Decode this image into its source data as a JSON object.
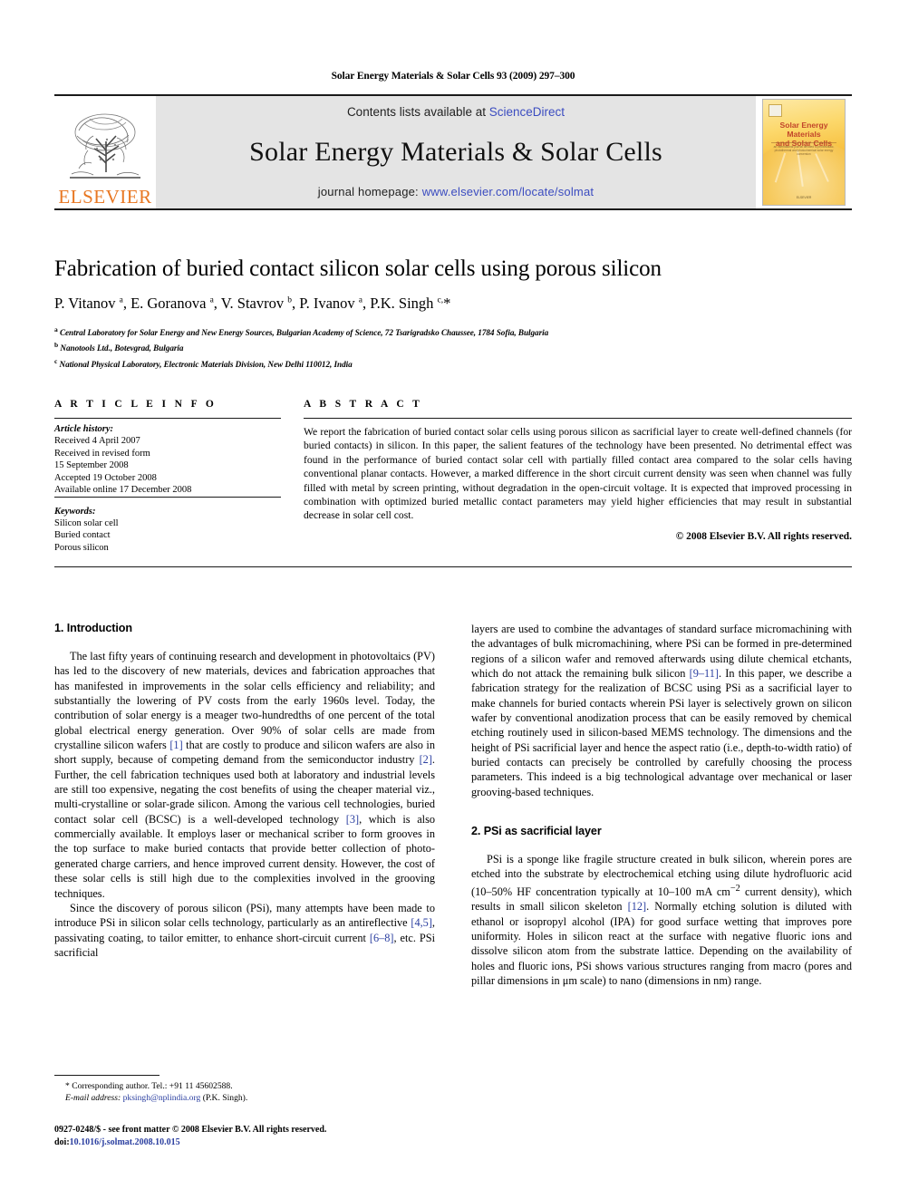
{
  "running_head": "Solar Energy Materials & Solar Cells 93 (2009) 297–300",
  "masthead": {
    "publisher_name": "ELSEVIER",
    "publisher_logo_icon": "elsevier-tree-icon",
    "contents_prefix": "Contents lists available at ",
    "contents_link": "ScienceDirect",
    "journal_title": "Solar Energy Materials & Solar Cells",
    "homepage_prefix": "journal homepage: ",
    "homepage_link": "www.elsevier.com/locate/solmat",
    "cover": {
      "title_line1": "Solar Energy Materials",
      "title_line2": "and Solar Cells",
      "subtitle": "an international journal devoted to photovoltaic, photothermal and photochemical solar energy conversion",
      "footer": "ELSEVIER"
    }
  },
  "colors": {
    "elsevier_orange": "#e87722",
    "link_blue": "#3b4cc0",
    "reference_blue": "#2b3fa0",
    "masthead_gray": "#e4e4e4",
    "cover_yellow": "#f7bf3e"
  },
  "article": {
    "title": "Fabrication of buried contact silicon solar cells using porous silicon",
    "authors_html": "P. Vitanov <sup>a</sup>, E. Goranova <sup>a</sup>, V. Stavrov <sup>b</sup>, P. Ivanov <sup>a</sup>, P.K. Singh <sup>c,</sup>*",
    "authors_plain": "P. Vitanov a, E. Goranova a, V. Stavrov b, P. Ivanov a, P.K. Singh c,*",
    "affiliations": [
      {
        "marker": "a",
        "text": "Central Laboratory for Solar Energy and New Energy Sources, Bulgarian Academy of Science, 72 Tsarigradsko Chaussee, 1784 Sofia, Bulgaria"
      },
      {
        "marker": "b",
        "text": "Nanotools Ltd., Botevgrad, Bulgaria"
      },
      {
        "marker": "c",
        "text": "National Physical Laboratory, Electronic Materials Division, New Delhi 110012, India"
      }
    ]
  },
  "article_info": {
    "heading": "A R T I C L E  I N F O",
    "history_label": "Article history:",
    "history_lines": [
      "Received 4 April 2007",
      "Received in revised form",
      "15 September 2008",
      "Accepted 19 October 2008",
      "Available online 17 December 2008"
    ],
    "keywords_label": "Keywords:",
    "keywords": [
      "Silicon solar cell",
      "Buried contact",
      "Porous silicon"
    ]
  },
  "abstract": {
    "heading": "A B S T R A C T",
    "text": "We report the fabrication of buried contact solar cells using porous silicon as sacrificial layer to create well-defined channels (for buried contacts) in silicon. In this paper, the salient features of the technology have been presented. No detrimental effect was found in the performance of buried contact solar cell with partially filled contact area compared to the solar cells having conventional planar contacts. However, a marked difference in the short circuit current density was seen when channel was fully filled with metal by screen printing, without degradation in the open-circuit voltage. It is expected that improved processing in combination with optimized buried metallic contact parameters may yield higher efficiencies that may result in substantial decrease in solar cell cost.",
    "copyright": "© 2008 Elsevier B.V. All rights reserved."
  },
  "body": {
    "section1_heading": "1.  Introduction",
    "section1_p1_a": "The last fifty years of continuing research and development in photovoltaics (PV) has led to the discovery of new materials, devices and fabrication approaches that has manifested in improvements in the solar cells efficiency and reliability; and substantially the lowering of PV costs from the early 1960s level. Today, the contribution of solar energy is a meager two-hundredths of one percent of the total global electrical energy generation. Over 90% of solar cells are made from crystalline silicon wafers ",
    "section1_p1_ref1": "[1]",
    "section1_p1_b": " that are costly to produce and silicon wafers are also in short supply, because of competing demand from the semiconductor industry ",
    "section1_p1_ref2": "[2]",
    "section1_p1_c": ". Further, the cell fabrication techniques used both at laboratory and industrial levels are still too expensive, negating the cost benefits of using the cheaper material viz., multi-crystalline or solar-grade silicon. Among the various cell technologies, buried contact solar cell (BCSC) is a well-developed technology ",
    "section1_p1_ref3": "[3]",
    "section1_p1_d": ", which is also commercially available. It employs laser or mechanical scriber to form grooves in the top surface to make buried contacts that provide better collection of photo-generated charge carriers, and hence improved current density. However, the cost of these solar cells is still high due to the complexities involved in the grooving techniques.",
    "section1_p2_a": "Since the discovery of porous silicon (PSi), many attempts have been made to introduce PSi in silicon solar cells technology, particularly as an antireflective ",
    "section1_p2_ref45": "[4,5]",
    "section1_p2_b": ", passivating coating, to tailor emitter, to enhance short-circuit current ",
    "section1_p2_ref68": "[6–8]",
    "section1_p2_c": ", etc. PSi sacrificial",
    "rcol_p1_a": "layers are used to combine the advantages of standard surface micromachining with the advantages of bulk micromachining, where PSi can be formed in pre-determined regions of a silicon wafer and removed afterwards using dilute chemical etchants, which do not attack the remaining bulk silicon ",
    "rcol_p1_ref911": "[9–11]",
    "rcol_p1_b": ". In this paper, we describe a fabrication strategy for the realization of BCSC using PSi as a sacrificial layer to make channels for buried contacts wherein PSi layer is selectively grown on silicon wafer by conventional anodization process that can be easily removed by chemical etching routinely used in silicon-based MEMS technology. The dimensions and the height of PSi sacrificial layer and hence the aspect ratio (i.e., depth-to-width ratio) of buried contacts can precisely be controlled by carefully choosing the process parameters. This indeed is a big technological advantage over mechanical or laser grooving-based techniques.",
    "section2_heading": "2.  PSi as sacrificial layer",
    "section2_p1_a": "PSi is a sponge like fragile structure created in bulk silicon, wherein pores are etched into the substrate by electrochemical etching using dilute hydrofluoric acid (10–50% HF concentration typically at 10–100 mA cm",
    "section2_p1_sup": "−2",
    "section2_p1_b": " current density), which results in small silicon skeleton ",
    "section2_p1_ref12": "[12]",
    "section2_p1_c": ". Normally etching solution is diluted with ethanol or isopropyl alcohol (IPA) for good surface wetting that improves pore uniformity. Holes in silicon react at the surface with negative fluoric ions and dissolve silicon atom from the substrate lattice. Depending on the availability of holes and fluoric ions, PSi shows various structures ranging from macro (pores and pillar dimensions in μm scale) to nano (dimensions in nm) range."
  },
  "footnote": {
    "corresponding_prefix": "* Corresponding author. Tel.: +91 11 45602588.",
    "email_label": "E-mail address:",
    "email": "pksingh@nplindia.org",
    "email_suffix": " (P.K. Singh)."
  },
  "bottom_matter": {
    "line1": "0927-0248/$ - see front matter © 2008 Elsevier B.V. All rights reserved.",
    "doi_label": "doi:",
    "doi_value": "10.1016/j.solmat.2008.10.015"
  }
}
